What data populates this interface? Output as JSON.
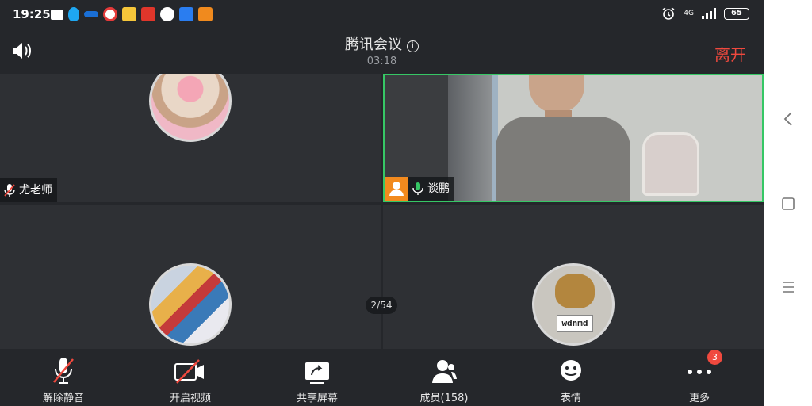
{
  "status_bar": {
    "time": "19:25",
    "network": "4G",
    "battery": "65",
    "notification_icons": [
      "sms-icon",
      "qq-icon",
      "app-icon",
      "app-icon",
      "app-icon",
      "news-icon",
      "app-icon",
      "app-icon",
      "app-icon"
    ]
  },
  "header": {
    "title": "腾讯会议",
    "timer": "03:18",
    "leave_label": "离开"
  },
  "participants": [
    {
      "name": "尤老师",
      "mic": "muted",
      "video": false
    },
    {
      "name": "谈鹏",
      "mic": "active",
      "video": true,
      "speaking": true
    },
    {
      "name": "",
      "mic": "",
      "video": false
    },
    {
      "name": "",
      "mic": "",
      "video": false,
      "avatar_text": "wdnmd"
    }
  ],
  "page_indicator": "2/54",
  "toolbar": {
    "unmute_label": "解除静音",
    "video_label": "开启视频",
    "share_label": "共享屏幕",
    "members_label": "成员(158)",
    "emoji_label": "表情",
    "more_label": "更多",
    "more_badge": "3"
  },
  "colors": {
    "background": "#25272b",
    "leave": "#f0493e",
    "speaking_border": "#36c765",
    "mic_active": "#36c765",
    "mic_muted": "#f0493e"
  }
}
